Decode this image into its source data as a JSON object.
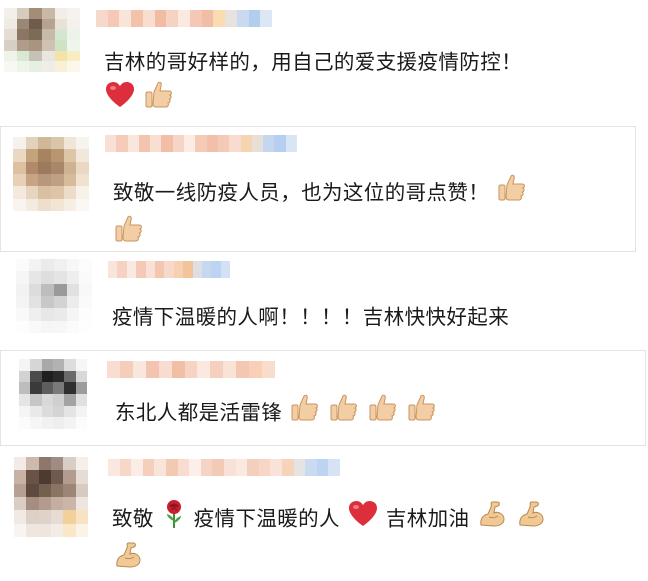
{
  "comments": [
    {
      "text": "吉林的哥好样的，用自己的爱支援疫情防控！",
      "emojis": [
        "red-heart",
        "thumbs-up"
      ],
      "avatar_colors": [
        "#f3efe9",
        "#d7cbbd",
        "#a48d77",
        "#c9b8a6",
        "#f2ede6",
        "#f6f3ef",
        "#eeeae4",
        "#9b8774",
        "#6e5b4b",
        "#b5a390",
        "#e7e1d8",
        "#f4f1ec",
        "#e5ddd3",
        "#8a7663",
        "#7d6b5a",
        "#c8baa9",
        "#d4e6cf",
        "#eef3e9",
        "#d6cfc5",
        "#b09c88",
        "#a99480",
        "#cfc2b3",
        "#cde3c6",
        "#f0f5eb",
        "#eef4e8",
        "#d9e8d3",
        "#c7c1b7",
        "#e9e5df",
        "#f4e3a8",
        "#f7ecc4",
        "#f7f8f4",
        "#eff4ea",
        "#e6efe2",
        "#f0ede8",
        "#f8f1d8",
        "#fbf7ea"
      ],
      "name_colors": [
        "#f7d9cc",
        "#f5c9b6",
        "#f9e4da",
        "#f3c2ab",
        "#f8ddd0",
        "#f2bca2",
        "#f6d2c2",
        "#fbe9e0",
        "#f4c8b4",
        "#f1bda5",
        "#fadcb0",
        "#e7e2dd",
        "#c9d9ef",
        "#b3cdee",
        "#dce7f5"
      ]
    },
    {
      "text": "致敬一线防疫人员，也为这位的哥点赞！",
      "emojis": [
        "thumbs-up",
        "thumbs-up"
      ],
      "avatar_colors": [
        "#f6f1ea",
        "#e3d2bb",
        "#cfb893",
        "#d9c6a9",
        "#efe6d9",
        "#f7f3ee",
        "#ead9c2",
        "#c4a27a",
        "#a78362",
        "#b8966f",
        "#dcc6a5",
        "#f1e8dc",
        "#dcc0a0",
        "#b08a6a",
        "#9d7a5e",
        "#a8866a",
        "#cfb290",
        "#ead8c2",
        "#e7d0b5",
        "#c6a484",
        "#b8987c",
        "#c09f82",
        "#d7bb9a",
        "#f0e2d0",
        "#f3e9dc",
        "#e8d5bd",
        "#d9c0a2",
        "#dec5a7",
        "#ecdcc8",
        "#f8f1e8",
        "#f8f4ef",
        "#f3ebe0",
        "#eedfcc",
        "#f1e5d5",
        "#f6eee3",
        "#fbf8f4"
      ],
      "name_colors": [
        "#f8e0d5",
        "#f5ccba",
        "#f9e7de",
        "#f3c4ae",
        "#f8dfd2",
        "#f2bfa6",
        "#f6d5c6",
        "#fbece4",
        "#f5cbb8",
        "#f2c0a9",
        "#f4c9b6",
        "#f8dccf",
        "#f7d4b0",
        "#e8dfd6",
        "#c4d7f0",
        "#b6cff0",
        "#d9e5f5"
      ]
    },
    {
      "text": "疫情下温暖的人啊！！！！吉林快快好起来",
      "emojis": [],
      "avatar_colors": [
        "#fbfbfb",
        "#f3f3f3",
        "#ebebeb",
        "#f0f0f0",
        "#f7f7f7",
        "#fcfcfc",
        "#f6f6f6",
        "#e6e6e6",
        "#dedede",
        "#e4e4e4",
        "#eeeeee",
        "#fafafa",
        "#f2f2f2",
        "#dcdcdc",
        "#bdbdbd",
        "#9a9a9a",
        "#e1e1e1",
        "#f8f8f8",
        "#f4f4f4",
        "#e2e2e2",
        "#c8c8c8",
        "#d3d3d3",
        "#ececec",
        "#fafafa",
        "#f9f9f9",
        "#efefef",
        "#e7e7e7",
        "#eaeaea",
        "#f5f5f5",
        "#fdfdfd",
        "#fdfdfd",
        "#f9f9f9",
        "#f6f6f6",
        "#f7f7f7",
        "#fbfbfb",
        "#fefefe"
      ],
      "name_colors": [
        "#f9e5dc",
        "#f6d2c2",
        "#fae9e1",
        "#f4cab7",
        "#f9e1d5",
        "#f3c6b0",
        "#f8d8ca",
        "#f7cfb2",
        "#f3c49a",
        "#dcdfe3",
        "#c6d8ef",
        "#bcd3f1",
        "#d2e1f3"
      ]
    },
    {
      "text": "东北人都是活雷锋",
      "emojis": [
        "thumbs-up",
        "thumbs-up",
        "thumbs-up",
        "thumbs-up"
      ],
      "avatar_colors": [
        "#f4f4f4",
        "#d6d6d6",
        "#a9a9a9",
        "#b2b2b2",
        "#dddddd",
        "#f6f6f6",
        "#d2d2d2",
        "#4b4b4b",
        "#1f1f1f",
        "#2a2a2a",
        "#6a6a6a",
        "#d8d8d8",
        "#bdbdbd",
        "#3a3a3a",
        "#5e5e5e",
        "#7a7a7a",
        "#2f2f2f",
        "#9c9c9c",
        "#e5e5e5",
        "#c6c6c6",
        "#d9d9d9",
        "#cfcfcf",
        "#a3a3a3",
        "#e0e0e0",
        "#f5f5f5",
        "#e9e9e9",
        "#dcdcdc",
        "#d4d4d4",
        "#e4e4e4",
        "#f3f3f3",
        "#fbfbfb",
        "#f6f6f6",
        "#f1f1f1",
        "#eeeeee",
        "#f3f3f3",
        "#fcfcfc"
      ],
      "name_colors": [
        "#f8ddd0",
        "#f5cdbb",
        "#f9e6dd",
        "#f3c5b0",
        "#f8dccf",
        "#f2bea6",
        "#f7d3c4",
        "#fbe9e1",
        "#f6d0bf",
        "#f9e2d6",
        "#f4c7b2",
        "#f7d0b6",
        "#f8ddcc"
      ]
    },
    {
      "text": "致敬",
      "text_b": "疫情下温暖的人",
      "text_c": "吉林加油",
      "emojis": [
        "rose",
        "red-heart",
        "flexed-biceps",
        "flexed-biceps",
        "flexed-biceps"
      ],
      "avatar_colors": [
        "#f2ebe6",
        "#cdb9ae",
        "#8f776b",
        "#a08c80",
        "#d9cdc5",
        "#f4efeb",
        "#c7b3a6",
        "#6b5246",
        "#4d3a31",
        "#6f5a4f",
        "#b19c8f",
        "#e5dcd6",
        "#b7a093",
        "#5f4a40",
        "#75604f",
        "#8a7464",
        "#9c8576",
        "#d8cac1",
        "#dccdc4",
        "#a58d7f",
        "#b39b8d",
        "#c4ae9f",
        "#c9b6a8",
        "#eee5df",
        "#f1e9e3",
        "#dfd0c6",
        "#e0d2c8",
        "#e6dcd4",
        "#f3cf9a",
        "#f7e3c3",
        "#f8f4f1",
        "#efe6e0",
        "#ede5de",
        "#f2ebe6",
        "#f9e7c8",
        "#fbf3e5"
      ],
      "name_colors": [
        "#fae8df",
        "#f6d7c8",
        "#fbece5",
        "#f4cfbd",
        "#f9e4d9",
        "#f3c9b4",
        "#f8dccf",
        "#fcefe9",
        "#f6d4c5",
        "#f3cab6",
        "#f8e1d6",
        "#fae9e1",
        "#f5cfbe",
        "#f7d6c6",
        "#f9e3d8",
        "#f6d4bb",
        "#e6e4e2",
        "#cadbf1",
        "#bcd4f2",
        "#d6e3f5"
      ]
    }
  ]
}
